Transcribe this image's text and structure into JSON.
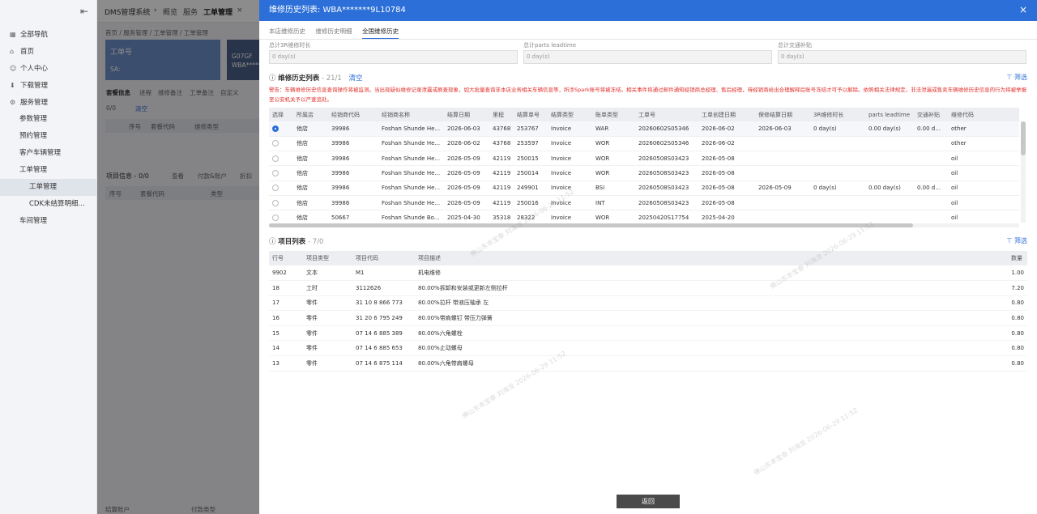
{
  "sidebar": {
    "items": [
      {
        "label": "全部导航",
        "icon": "grid-icon"
      },
      {
        "label": "首页",
        "icon": "home-icon"
      },
      {
        "label": "个人中心",
        "icon": "user-icon"
      },
      {
        "label": "下载管理",
        "icon": "download-icon"
      },
      {
        "label": "服务管理",
        "icon": "service-icon"
      },
      {
        "label": "参数管理"
      },
      {
        "label": "预约管理"
      },
      {
        "label": "客户车辆管理"
      },
      {
        "label": "工单管理"
      },
      {
        "label": "工单管理"
      },
      {
        "label": "CDK未结算明细..."
      },
      {
        "label": "车间管理"
      }
    ]
  },
  "topbar": {
    "system": "DMS管理系统",
    "tab_overview": "概览",
    "tab_service": "服务",
    "tab_active": "工单管理"
  },
  "background": {
    "breadcrumb": "首页 / 服务管理 / 工单管理 / 工单管理",
    "card_title": "工单号",
    "card_sa": "SA:",
    "card2_line1": "G07GF",
    "card2_line2": "WBA*****",
    "tabs": [
      "套餐信息",
      "进程",
      "维修备注",
      "工单备注",
      "自定义"
    ],
    "pkg_count": "0/0",
    "pkg_clear": "清空",
    "pkg_cols": [
      "序号",
      "套餐代码",
      "维修类型"
    ],
    "items_title": "项目信息",
    "items_count": "- 0/0",
    "items_actions": [
      "查看",
      "付款&账户",
      "折扣"
    ],
    "items_cols": [
      "序号",
      "套餐代码",
      "类型"
    ],
    "footer": [
      "结算账户",
      "付款类型"
    ]
  },
  "modal": {
    "title": "维修历史列表: WBA*******9L10784",
    "tabs": [
      "本店维修历史",
      "维修历史明细",
      "全国维修历史"
    ],
    "summary": [
      {
        "label": "总计3R维修时长",
        "value": "0 day(s)"
      },
      {
        "label": "总计parts leadtime",
        "value": "0 day(s)"
      },
      {
        "label": "总计交通补贴",
        "value": "0 day(s)"
      }
    ],
    "history_title": "维修历史列表",
    "history_count": "- 21/1",
    "clear": "清空",
    "filter": "筛选",
    "warning": "警告：车辆维修历史信息查询操作将被监测。当出现疑似维修记录泄露或刷查现象，如大批量查询非本店业务相关车辆信息等，所涉Spark账号将被冻结。相关事件将通过邮件通知经销商总经理、售后经理，待经销商给出合理解释后账号冻结才可予以解除。依照相关法律规定，非法泄漏或售卖车辆维修历史信息的行为将被举报至公安机关予以严查追处。",
    "history_columns": [
      "选择",
      "所属店",
      "经销商代码",
      "经销商名称",
      "结算日期",
      "里程",
      "结算单号",
      "结算类型",
      "账单类型",
      "工单号",
      "工单创建日期",
      "保修结算日期",
      "3R维修时长",
      "parts leadtime",
      "交通补贴",
      "维修代码"
    ],
    "history_rows": [
      {
        "selected": true,
        "store": "他店",
        "dealer_code": "39986",
        "dealer_name": "Foshan Shunde He...",
        "settle_date": "2026-06-03",
        "mileage": "43768",
        "settle_no": "253767",
        "settle_type": "Invoice",
        "bill_type": "WAR",
        "ro_no": "20260602S05346",
        "ro_date": "2026-06-02",
        "warranty_date": "2026-06-03",
        "r3": "0 day(s)",
        "parts": "0.00 day(s)",
        "traffic": "0.00 d...",
        "code": "other"
      },
      {
        "selected": false,
        "store": "他店",
        "dealer_code": "39986",
        "dealer_name": "Foshan Shunde He...",
        "settle_date": "2026-06-02",
        "mileage": "43768",
        "settle_no": "253597",
        "settle_type": "Invoice",
        "bill_type": "WOR",
        "ro_no": "20260602S05346",
        "ro_date": "2026-06-02",
        "warranty_date": "",
        "r3": "",
        "parts": "",
        "traffic": "",
        "code": "other"
      },
      {
        "selected": false,
        "store": "他店",
        "dealer_code": "39986",
        "dealer_name": "Foshan Shunde He...",
        "settle_date": "2026-05-09",
        "mileage": "42119",
        "settle_no": "250015",
        "settle_type": "Invoice",
        "bill_type": "WOR",
        "ro_no": "20260508S03423",
        "ro_date": "2026-05-08",
        "warranty_date": "",
        "r3": "",
        "parts": "",
        "traffic": "",
        "code": "oil"
      },
      {
        "selected": false,
        "store": "他店",
        "dealer_code": "39986",
        "dealer_name": "Foshan Shunde He...",
        "settle_date": "2026-05-09",
        "mileage": "42119",
        "settle_no": "250014",
        "settle_type": "Invoice",
        "bill_type": "WOR",
        "ro_no": "20260508S03423",
        "ro_date": "2026-05-08",
        "warranty_date": "",
        "r3": "",
        "parts": "",
        "traffic": "",
        "code": "oil"
      },
      {
        "selected": false,
        "store": "他店",
        "dealer_code": "39986",
        "dealer_name": "Foshan Shunde He...",
        "settle_date": "2026-05-09",
        "mileage": "42119",
        "settle_no": "249901",
        "settle_type": "Invoice",
        "bill_type": "BSI",
        "ro_no": "20260508S03423",
        "ro_date": "2026-05-08",
        "warranty_date": "2026-05-09",
        "r3": "0 day(s)",
        "parts": "0.00 day(s)",
        "traffic": "0.00 d...",
        "code": "oil"
      },
      {
        "selected": false,
        "store": "他店",
        "dealer_code": "39986",
        "dealer_name": "Foshan Shunde He...",
        "settle_date": "2026-05-09",
        "mileage": "42119",
        "settle_no": "250016",
        "settle_type": "Invoice",
        "bill_type": "INT",
        "ro_no": "20260508S03423",
        "ro_date": "2026-05-08",
        "warranty_date": "",
        "r3": "",
        "parts": "",
        "traffic": "",
        "code": "oil"
      },
      {
        "selected": false,
        "store": "他店",
        "dealer_code": "50667",
        "dealer_name": "Foshan Shunde Bo...",
        "settle_date": "2025-04-30",
        "mileage": "35318",
        "settle_no": "28322",
        "settle_type": "Invoice",
        "bill_type": "WOR",
        "ro_no": "20250420S17754",
        "ro_date": "2025-04-20",
        "warranty_date": "",
        "r3": "",
        "parts": "",
        "traffic": "",
        "code": "oil"
      }
    ],
    "items_title": "项目列表",
    "items_count": "- 7/0",
    "item_columns": [
      "行号",
      "项目类型",
      "项目代码",
      "项目描述",
      "数量"
    ],
    "items": [
      {
        "line": "9902",
        "type": "文本",
        "code": "M1",
        "desc": "机电维修",
        "qty": "1.00"
      },
      {
        "line": "18",
        "type": "工时",
        "code": "3112626",
        "desc": "80.00%拆卸和安装或更新左侧拉杆",
        "qty": "7.20"
      },
      {
        "line": "17",
        "type": "零件",
        "code": "31 10 8 866 773",
        "desc": "80.00%拉杆 带液压轴承 左",
        "qty": "0.80"
      },
      {
        "line": "16",
        "type": "零件",
        "code": "31 20 6 795 249",
        "desc": "80.00%带肩螺钉 带压力弹簧",
        "qty": "0.80"
      },
      {
        "line": "15",
        "type": "零件",
        "code": "07 14 6 885 389",
        "desc": "80.00%六角螺栓",
        "qty": "0.80"
      },
      {
        "line": "14",
        "type": "零件",
        "code": "07 14 6 885 653",
        "desc": "80.00%止动螺母",
        "qty": "0.80"
      },
      {
        "line": "13",
        "type": "零件",
        "code": "07 14 6 875 114",
        "desc": "80.00%六角带肩螺母",
        "qty": "0.80"
      }
    ],
    "back_label": "返回",
    "watermark": "佛山东本宝泰 刘海龙 2026-06-29 11:52"
  }
}
